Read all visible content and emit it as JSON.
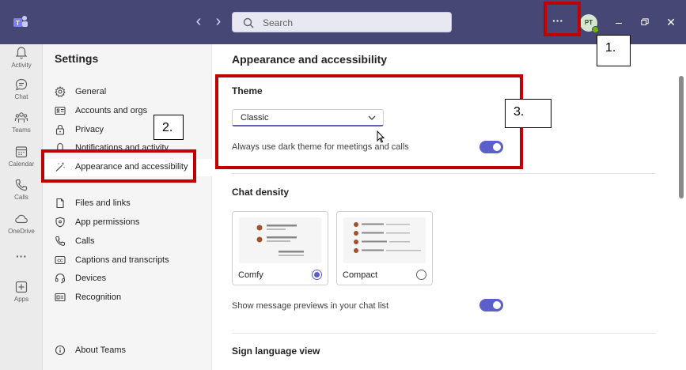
{
  "titlebar": {
    "search_placeholder": "Search",
    "more_label": "···",
    "avatar_initials": "PT"
  },
  "rail": {
    "items": [
      {
        "label": "Activity",
        "icon": "bell-icon"
      },
      {
        "label": "Chat",
        "icon": "chat-icon"
      },
      {
        "label": "Teams",
        "icon": "teams-icon"
      },
      {
        "label": "Calendar",
        "icon": "calendar-icon"
      },
      {
        "label": "Calls",
        "icon": "phone-icon"
      },
      {
        "label": "OneDrive",
        "icon": "cloud-icon"
      },
      {
        "label": "···",
        "icon": "more-icon"
      },
      {
        "label": "Apps",
        "icon": "apps-icon"
      }
    ]
  },
  "settings": {
    "title": "Settings",
    "items": [
      {
        "label": "General",
        "icon": "gear-icon"
      },
      {
        "label": "Accounts and orgs",
        "icon": "id-card-icon"
      },
      {
        "label": "Privacy",
        "icon": "lock-icon"
      },
      {
        "label": "Notifications and activity",
        "icon": "bell-icon"
      },
      {
        "label": "Appearance and accessibility",
        "icon": "magic-wand-icon"
      },
      {
        "label": "Files and links",
        "icon": "file-icon"
      },
      {
        "label": "App permissions",
        "icon": "shield-icon"
      },
      {
        "label": "Calls",
        "icon": "phone-icon"
      },
      {
        "label": "Captions and transcripts",
        "icon": "captions-icon"
      },
      {
        "label": "Devices",
        "icon": "headset-icon"
      },
      {
        "label": "Recognition",
        "icon": "recognition-icon"
      }
    ],
    "about": "About Teams"
  },
  "main": {
    "heading": "Appearance and accessibility",
    "theme": {
      "title": "Theme",
      "selected": "Classic",
      "dark_meetings_label": "Always use dark theme for meetings and calls",
      "dark_meetings_on": true
    },
    "chat_density": {
      "title": "Chat density",
      "options": [
        {
          "label": "Comfy",
          "selected": true
        },
        {
          "label": "Compact",
          "selected": false
        }
      ],
      "previews_label": "Show message previews in your chat list",
      "previews_on": true
    },
    "sign_language_title": "Sign language view"
  },
  "annotations": {
    "step1": "1.",
    "step2": "2.",
    "step3": "3."
  },
  "colors": {
    "titlebar": "#464775",
    "accent": "#5b5fc7",
    "annotation": "#c00000"
  }
}
